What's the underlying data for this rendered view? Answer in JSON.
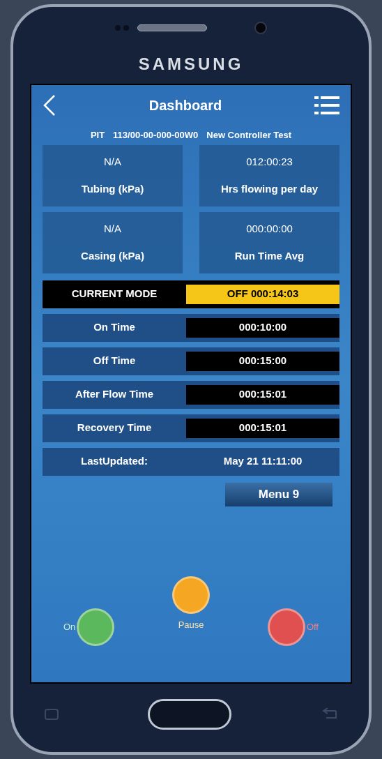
{
  "phone": {
    "brand": "SAMSUNG"
  },
  "header": {
    "title": "Dashboard"
  },
  "subtitle": {
    "site": "PIT",
    "location": "113/00-00-000-00W0",
    "name": "New Controller Test"
  },
  "cards": [
    {
      "value": "N/A",
      "label": "Tubing (kPa)"
    },
    {
      "value": "012:00:23",
      "label": "Hrs flowing per day"
    },
    {
      "value": "N/A",
      "label": "Casing (kPa)"
    },
    {
      "value": "000:00:00",
      "label": "Run Time Avg"
    }
  ],
  "rows": [
    {
      "kind": "mode",
      "label": "CURRENT MODE",
      "value": "OFF 000:14:03"
    },
    {
      "kind": "timer",
      "label": "On Time",
      "value": "000:10:00"
    },
    {
      "kind": "timer",
      "label": "Off Time",
      "value": "000:15:00"
    },
    {
      "kind": "timer",
      "label": "After Flow Time",
      "value": "000:15:01"
    },
    {
      "kind": "timer",
      "label": "Recovery Time",
      "value": "000:15:01"
    },
    {
      "kind": "info",
      "label": "LastUpdated:",
      "value": "May 21 11:11:00"
    }
  ],
  "menu_button": {
    "label": "Menu 9"
  },
  "controls": [
    {
      "label": "On",
      "kind": "left",
      "color": "#5cb85c"
    },
    {
      "label": "Pause",
      "kind": "below",
      "color": "#f5a623"
    },
    {
      "label": "Off",
      "kind": "right",
      "color": "#e05050"
    }
  ]
}
